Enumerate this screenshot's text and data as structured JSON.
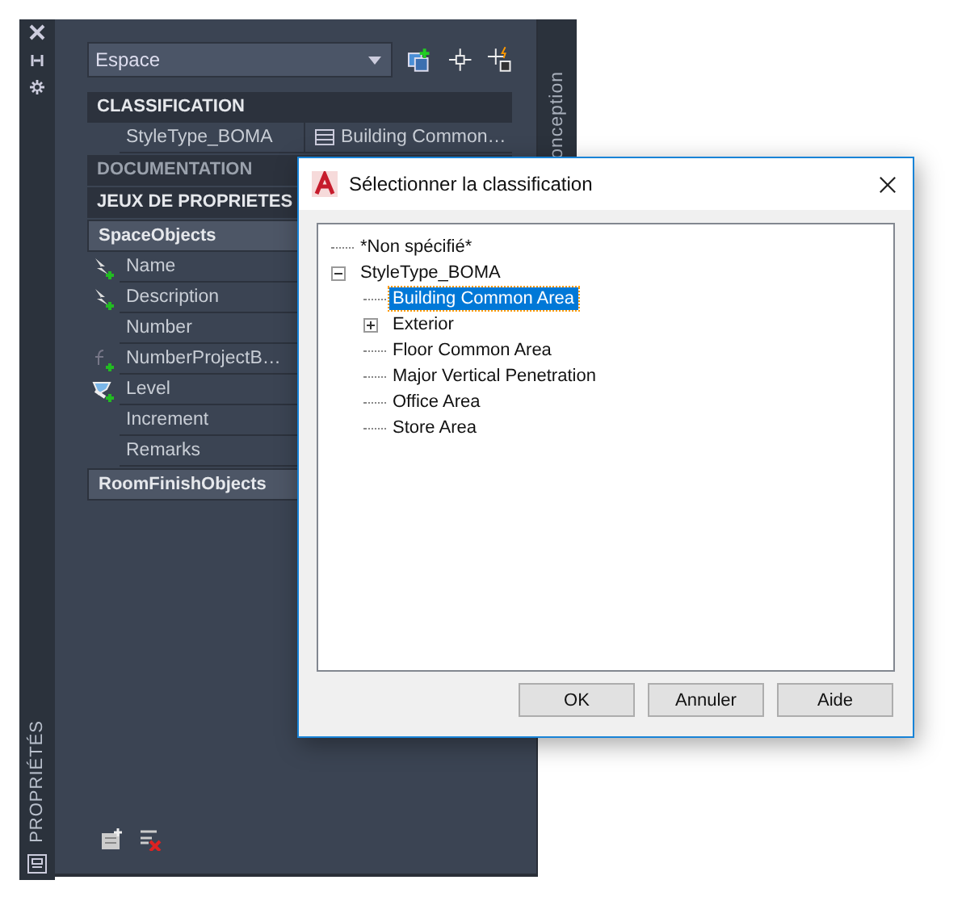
{
  "palette": {
    "side_tab": "PROPRIÉTÉS",
    "right_tab": "onception",
    "dropdown": {
      "value": "Espace"
    }
  },
  "sections": [
    {
      "kind": "category",
      "label": "CLASSIFICATION",
      "disabled": false,
      "rows": [
        {
          "kind": "none",
          "name": "StyleType_BOMA",
          "value": "Building  Common…"
        }
      ]
    },
    {
      "kind": "category",
      "label": "DOCUMENTATION",
      "disabled": true
    },
    {
      "kind": "category",
      "label": "JEUX DE PROPRIETES",
      "disabled": false
    },
    {
      "kind": "group",
      "label": "SpaceObjects",
      "disabled": false,
      "rows": [
        {
          "kind": "auto",
          "name": "Name"
        },
        {
          "kind": "auto",
          "name": "Description"
        },
        {
          "kind": "none",
          "name": "Number"
        },
        {
          "kind": "formula",
          "name": "NumberProjectB…"
        },
        {
          "kind": "classify",
          "name": "Level"
        },
        {
          "kind": "none",
          "name": "Increment"
        },
        {
          "kind": "none",
          "name": "Remarks"
        }
      ]
    },
    {
      "kind": "group",
      "label": "RoomFinishObjects",
      "disabled": false
    }
  ],
  "dialog": {
    "title": "Sélectionner la classification",
    "tree": [
      {
        "label": "*Non spécifié*",
        "kind": "leaf",
        "selected": false
      },
      {
        "label": "StyleType_BOMA",
        "kind": "node",
        "expanded": true,
        "selected": false,
        "children": [
          {
            "label": "Building Common Area",
            "kind": "leaf",
            "selected": true
          },
          {
            "label": "Exterior",
            "kind": "node",
            "expanded": false,
            "selected": false
          },
          {
            "label": "Floor Common Area",
            "kind": "leaf",
            "selected": false
          },
          {
            "label": "Major Vertical Penetration",
            "kind": "leaf",
            "selected": false
          },
          {
            "label": "Office Area",
            "kind": "leaf",
            "selected": false
          },
          {
            "label": "Store Area",
            "kind": "leaf",
            "selected": false
          }
        ]
      }
    ],
    "buttons": [
      "OK",
      "Annuler",
      "Aide"
    ]
  }
}
